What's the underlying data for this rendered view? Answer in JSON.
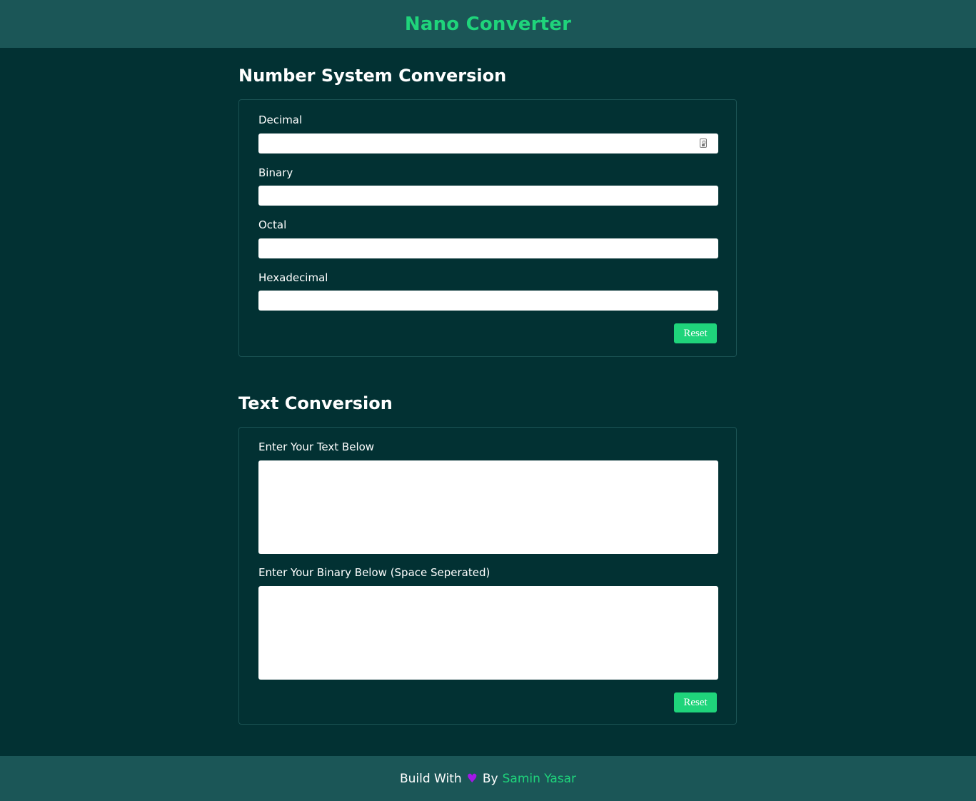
{
  "header": {
    "brand": "Nano Converter"
  },
  "number_section": {
    "title": "Number System Conversion",
    "fields": [
      {
        "label": "Decimal",
        "value": ""
      },
      {
        "label": "Binary",
        "value": ""
      },
      {
        "label": "Octal",
        "value": ""
      },
      {
        "label": "Hexadecimal",
        "value": ""
      }
    ],
    "reset_label": "Reset"
  },
  "text_section": {
    "title": "Text Conversion",
    "text_label": "Enter Your Text Below",
    "text_value": "",
    "binary_label": "Enter Your Binary Below (Space Seperated)",
    "binary_value": "",
    "reset_label": "Reset"
  },
  "footer": {
    "prefix": "Build With",
    "heart_glyph": "♥",
    "middle": "By",
    "author": "Samin Yasar"
  },
  "colors": {
    "page_bg": "#023133",
    "bar_bg": "#1b5657",
    "accent": "#1fd47b",
    "heart": "#a317e8"
  },
  "icons": {
    "decimal_field": "autofill-contact-icon",
    "footer_heart": "heart-icon"
  }
}
